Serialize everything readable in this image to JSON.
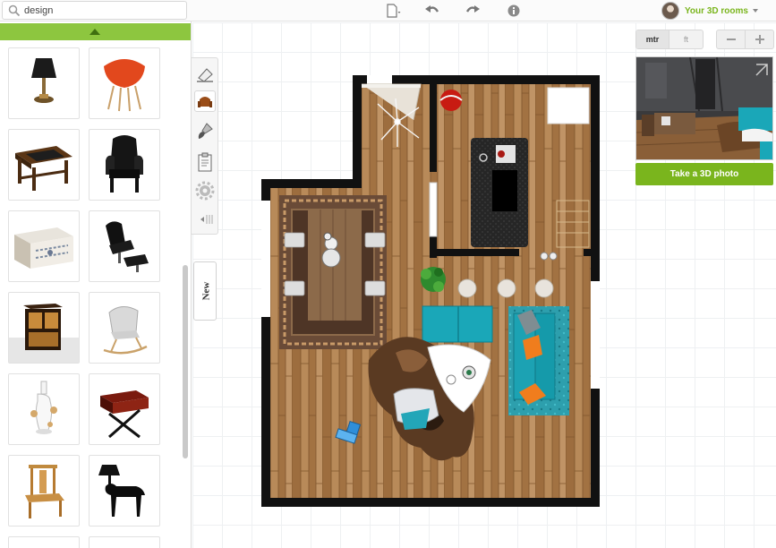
{
  "search": {
    "value": "design"
  },
  "account": {
    "label": "Your 3D rooms"
  },
  "units": {
    "metric": "mtr",
    "imperial": "ft"
  },
  "tools": {
    "new_label": "New"
  },
  "preview": {
    "photo_button": "Take a 3D photo"
  },
  "catalog": {
    "items": [
      {
        "name": "table lamp"
      },
      {
        "name": "orange armchair"
      },
      {
        "name": "wooden desk"
      },
      {
        "name": "black armchair"
      },
      {
        "name": "white chest"
      },
      {
        "name": "lounge chair"
      },
      {
        "name": "wooden cabinet"
      },
      {
        "name": "rocking chair"
      },
      {
        "name": "white vase"
      },
      {
        "name": "red side table"
      },
      {
        "name": "wooden chair"
      },
      {
        "name": "horse lamp"
      }
    ]
  },
  "colors": {
    "brand_green": "#7ab51d",
    "catalog_bar": "#8dc63f",
    "wall": "#111111",
    "wood_floor": "#a87b4d",
    "accent_teal": "#1eaab7"
  }
}
